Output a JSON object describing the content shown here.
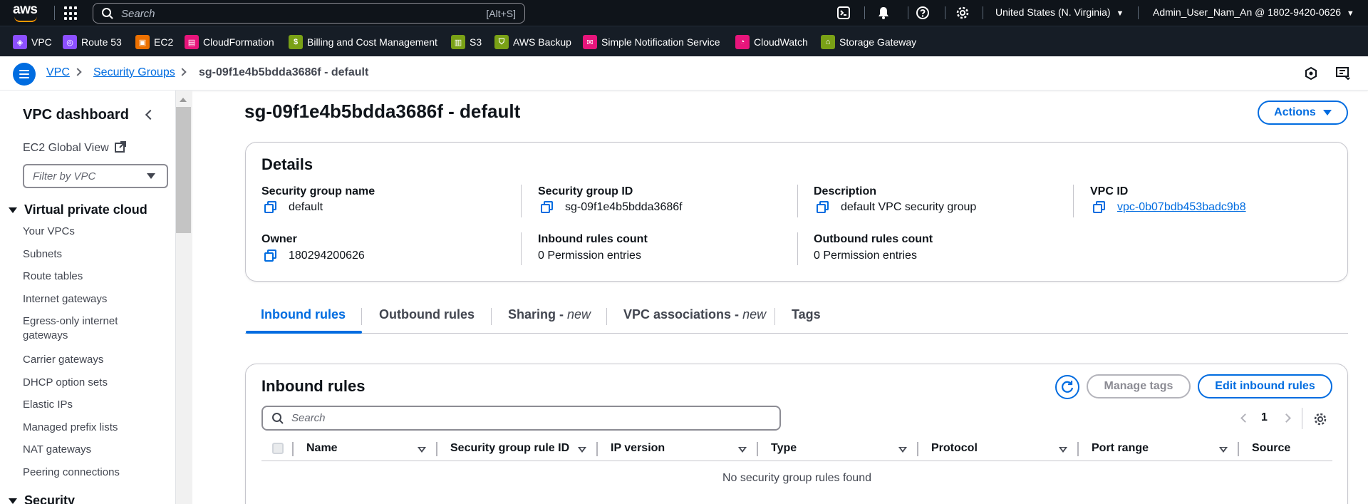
{
  "top_nav": {
    "logo": "aws",
    "search_placeholder": "Search",
    "search_shortcut": "[Alt+S]",
    "icons": [
      "cloudshell-icon",
      "bell-icon",
      "help-icon",
      "gear-icon"
    ],
    "region": "United States (N. Virginia)",
    "account": "Admin_User_Nam_An @ 1802-9420-0626"
  },
  "favorites": [
    {
      "label": "VPC",
      "color": "#8c4fff"
    },
    {
      "label": "Route 53",
      "color": "#8c4fff"
    },
    {
      "label": "EC2",
      "color": "#ed7100"
    },
    {
      "label": "CloudFormation",
      "color": "#e7157b"
    },
    {
      "label": "Billing and Cost Management",
      "color": "#7aa116"
    },
    {
      "label": "S3",
      "color": "#7aa116"
    },
    {
      "label": "AWS Backup",
      "color": "#7aa116"
    },
    {
      "label": "Simple Notification Service",
      "color": "#e7157b"
    },
    {
      "label": "CloudWatch",
      "color": "#e7157b"
    },
    {
      "label": "Storage Gateway",
      "color": "#7aa116"
    }
  ],
  "breadcrumb": {
    "items": [
      "VPC",
      "Security Groups"
    ],
    "current": "sg-09f1e4b5bdda3686f - default"
  },
  "sidebar": {
    "title": "VPC dashboard",
    "global_view": "EC2 Global View",
    "filter_placeholder": "Filter by VPC",
    "section": "Virtual private cloud",
    "items": [
      "Your VPCs",
      "Subnets",
      "Route tables",
      "Internet gateways",
      "Egress-only internet gateways",
      "Carrier gateways",
      "DHCP option sets",
      "Elastic IPs",
      "Managed prefix lists",
      "NAT gateways",
      "Peering connections"
    ],
    "section2": "Security"
  },
  "main": {
    "title": "sg-09f1e4b5bdda3686f - default",
    "actions_label": "Actions",
    "details": {
      "heading": "Details",
      "fields": [
        {
          "label": "Security group name",
          "value": "default"
        },
        {
          "label": "Security group ID",
          "value": "sg-09f1e4b5bdda3686f"
        },
        {
          "label": "Description",
          "value": "default VPC security group"
        },
        {
          "label": "VPC ID",
          "value": "vpc-0b07bdb453badc9b8"
        },
        {
          "label": "Owner",
          "value": "180294200626"
        },
        {
          "label": "Inbound rules count",
          "value": "0 Permission entries"
        },
        {
          "label": "Outbound rules count",
          "value": "0 Permission entries"
        }
      ]
    },
    "tabs": [
      {
        "label": "Inbound rules",
        "suffix": ""
      },
      {
        "label": "Outbound rules",
        "suffix": ""
      },
      {
        "label": "Sharing - ",
        "suffix": "new"
      },
      {
        "label": "VPC associations - ",
        "suffix": "new"
      },
      {
        "label": "Tags",
        "suffix": ""
      }
    ],
    "rules": {
      "heading": "Inbound rules",
      "manage_tags": "Manage tags",
      "edit_rules": "Edit inbound rules",
      "search_placeholder": "Search",
      "page": "1",
      "columns": [
        "Name",
        "Security group rule ID",
        "IP version",
        "Type",
        "Protocol",
        "Port range",
        "Source"
      ],
      "empty": "No security group rules found"
    }
  }
}
